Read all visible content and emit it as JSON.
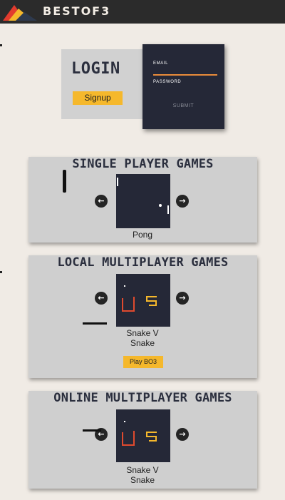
{
  "header": {
    "brand": "BESTOF3",
    "logo_colors": [
      "#e23b2e",
      "#f5b82c",
      "#2e3a4e"
    ]
  },
  "login": {
    "title": "LOGIN",
    "signup_label": "Signup",
    "email_label": "EMAIL",
    "password_label": "PASSWORD",
    "submit_label": "SUBMIT"
  },
  "sections": [
    {
      "title": "SINGLE PLAYER GAMES",
      "game": "Pong",
      "prev_icon": "arrow-left-icon",
      "next_icon": "arrow-right-icon"
    },
    {
      "title": "LOCAL MULTIPLAYER GAMES",
      "game_line1": "Snake V",
      "game_line2": "Snake",
      "play_label": "Play BO3"
    },
    {
      "title": "ONLINE MULTIPLAYER GAMES",
      "game_line1": "Snake V",
      "game_line2": "Snake"
    }
  ],
  "colors": {
    "accent": "#f5b82c",
    "dark_panel": "#252837",
    "section_bg": "#cfcfcf",
    "page_bg": "#f0ebe5",
    "snake_red": "#e04a2e",
    "snake_yellow": "#f5b82c",
    "email_underline": "#e88b3a"
  }
}
